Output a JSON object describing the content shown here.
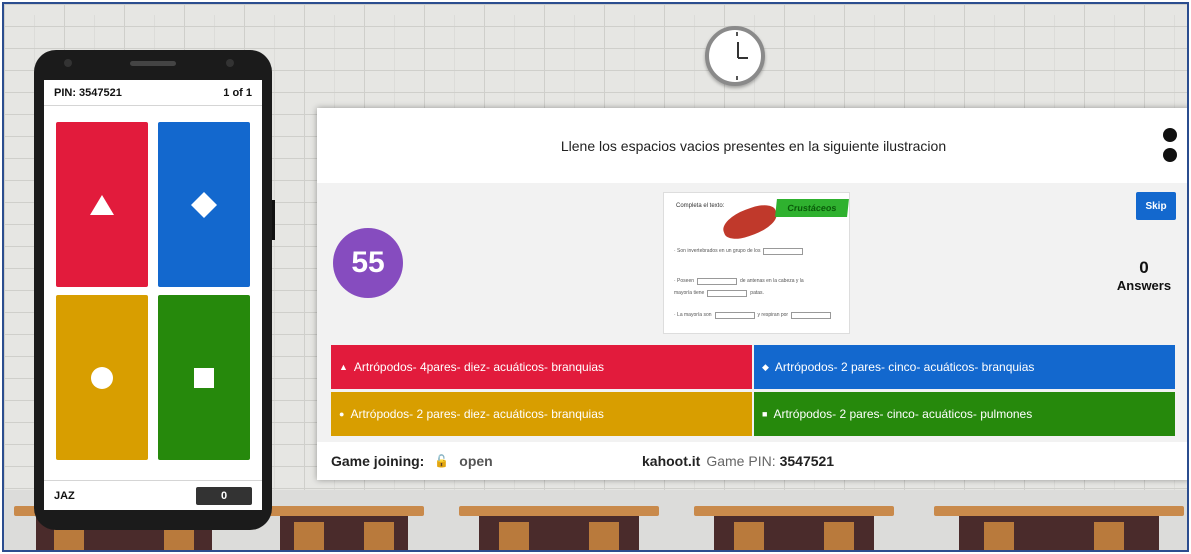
{
  "phone": {
    "pin_label": "PIN: 3547521",
    "progress": "1 of 1",
    "tiles": [
      {
        "shape": "▲",
        "color": "#e21b3c"
      },
      {
        "shape": "◆",
        "color": "#1368ce"
      },
      {
        "shape": "●",
        "color": "#d89e00"
      },
      {
        "shape": "■",
        "color": "#26890c"
      }
    ],
    "player_name": "JAZ",
    "score": "0"
  },
  "board": {
    "question": "Llene los espacios vacios presentes en la siguiente ilustracion",
    "timer": "55",
    "skip_label": "Skip",
    "answers_count": "0",
    "answers_label": "Answers",
    "media": {
      "title": "Completa el texto:",
      "green_title": "Crustáceos",
      "lines": [
        "· Son invertebrados en un grupo de los",
        "· Poseen",
        "de antenas en la cabeza y la",
        "mayoría tiene",
        "patas.",
        "· La mayoría son",
        "y respiran por"
      ]
    },
    "answers": [
      {
        "shape": "▲",
        "text": "Artrópodos- 4pares- diez- acuáticos- branquias",
        "color": "#e21b3c"
      },
      {
        "shape": "◆",
        "text": "Artrópodos- 2 pares- cinco- acuáticos- branquias",
        "color": "#1368ce"
      },
      {
        "shape": "●",
        "text": "Artrópodos- 2 pares- diez- acuáticos- branquias",
        "color": "#d89e00"
      },
      {
        "shape": "■",
        "text": "Artrópodos- 2 pares- cinco- acuáticos- pulmones",
        "color": "#26890c"
      }
    ],
    "footer": {
      "game_joining": "Game joining:",
      "lock_icon": "🔓",
      "status": "open",
      "site": "kahoot.it",
      "pin_label": "Game PIN:",
      "pin": "3547521"
    }
  }
}
